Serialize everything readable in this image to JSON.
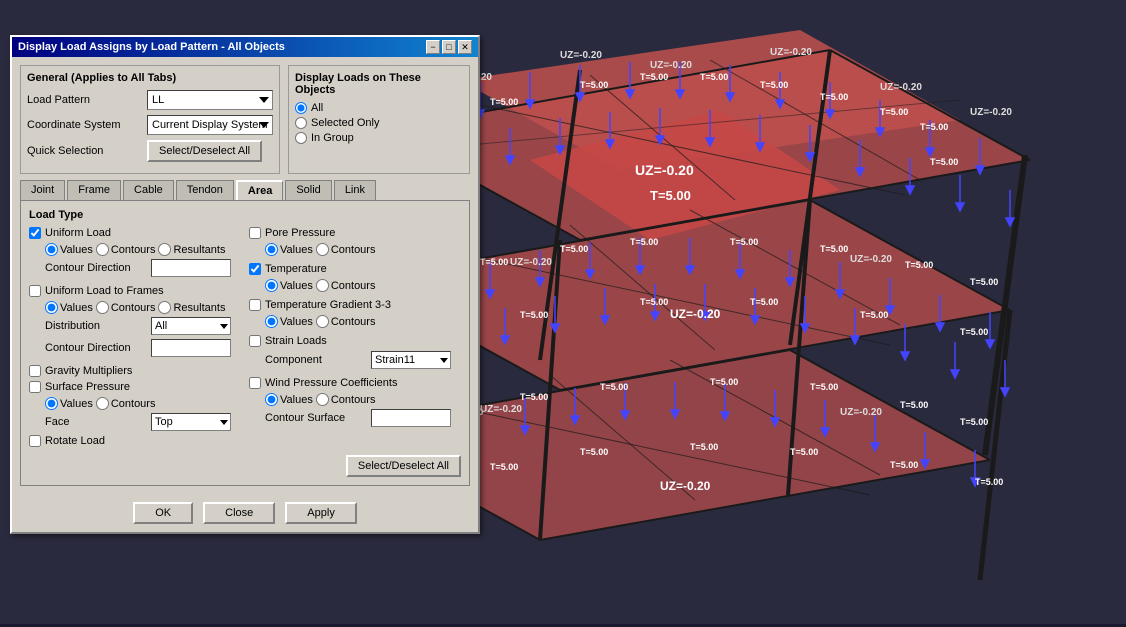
{
  "background": {
    "color": "#2a2a3e"
  },
  "dialog": {
    "title": "Display Load Assigns by Load Pattern - All Objects",
    "minimize_btn": "−",
    "maximize_btn": "□",
    "close_btn": "✕",
    "general_section_title": "General  (Applies to All Tabs)",
    "load_pattern_label": "Load Pattern",
    "load_pattern_value": "LL",
    "coord_system_label": "Coordinate System",
    "coord_system_value": "Current Display System",
    "quick_selection_label": "Quick Selection",
    "select_deselect_btn": "Select/Deselect All",
    "display_loads_title": "Display Loads on These Objects",
    "all_radio": "All",
    "selected_only_radio": "Selected Only",
    "in_group_radio": "In Group",
    "tabs": [
      "Joint",
      "Frame",
      "Cable",
      "Tendon",
      "Area",
      "Solid",
      "Link"
    ],
    "active_tab": "Area",
    "load_type_title": "Load Type",
    "uniform_load_cb": "Uniform Load",
    "uniform_load_checked": true,
    "ul_values_radio": "Values",
    "ul_contours_radio": "Contours",
    "ul_resultants_radio": "Resultants",
    "contour_direction_label": "Contour Direction",
    "contour_direction_value": "",
    "uniform_frames_cb": "Uniform Load to Frames",
    "uniform_frames_checked": false,
    "uf_values_radio": "Values",
    "uf_contours_radio": "Contours",
    "uf_resultants_radio": "Resultants",
    "distribution_label": "Distribution",
    "distribution_value": "All",
    "contour_dir2_label": "Contour Direction",
    "contour_dir2_value": "",
    "gravity_cb": "Gravity Multipliers",
    "gravity_checked": false,
    "surface_pressure_cb": "Surface Pressure",
    "surface_pressure_checked": false,
    "sp_values_radio": "Values",
    "sp_contours_radio": "Contours",
    "face_label": "Face",
    "face_value": "Top",
    "rotate_load_cb": "Rotate Load",
    "rotate_load_checked": false,
    "pore_pressure_cb": "Pore Pressure",
    "pore_pressure_checked": false,
    "pp_values_radio": "Values",
    "pp_contours_radio": "Contours",
    "temperature_cb": "Temperature",
    "temperature_checked": true,
    "temp_values_radio": "Values",
    "temp_contours_radio": "Contours",
    "temp_gradient_cb": "Temperature Gradient 3-3",
    "temp_gradient_checked": false,
    "tg_values_radio": "Values",
    "tg_contours_radio": "Contours",
    "strain_loads_cb": "Strain Loads",
    "strain_loads_checked": false,
    "component_label": "Component",
    "component_value": "Strain11",
    "wind_pressure_cb": "Wind Pressure Coefficients",
    "wind_pressure_checked": false,
    "wp_values_radio": "Values",
    "wp_contours_radio": "Contours",
    "contour_surface_label": "Contour Surface",
    "contour_surface_value": "",
    "bottom_select_btn": "Select/Deselect All",
    "ok_btn": "OK",
    "close_dialog_btn": "Close",
    "apply_btn": "Apply"
  }
}
